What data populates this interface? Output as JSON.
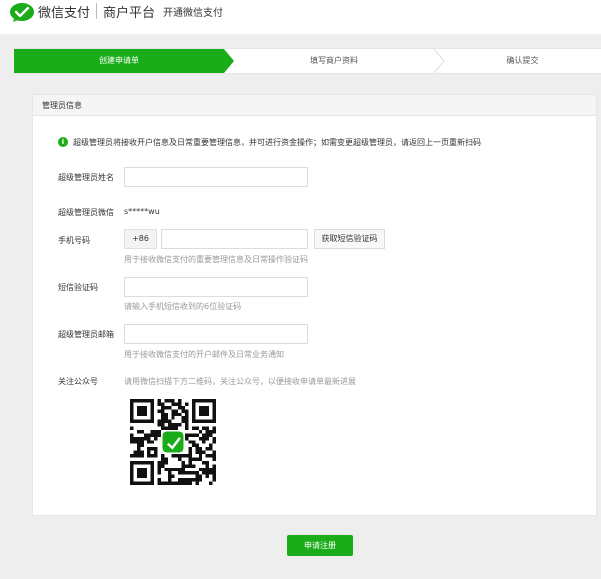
{
  "header": {
    "brand": "微信支付",
    "platform": "商户平台",
    "subtitle": "开通微信支付"
  },
  "steps": [
    {
      "label": "创建申请单",
      "active": true
    },
    {
      "label": "填写商户资料",
      "active": false
    },
    {
      "label": "确认提交",
      "active": false
    }
  ],
  "card": {
    "title": "管理员信息",
    "notice": "超级管理员将接收开户信息及日常重要管理信息，并可进行资金操作；如需变更超级管理员，请返回上一页重新扫码"
  },
  "form": {
    "name_label": "超级管理员姓名",
    "name_value": "",
    "wechat_label": "超级管理员微信",
    "wechat_value": "s*****wu",
    "phone_label": "手机号码",
    "phone_prefix": "+86",
    "phone_value": "",
    "sms_button": "获取短信验证码",
    "phone_hint": "用于接收微信支付的重要管理信息及日常操作验证码",
    "code_label": "短信验证码",
    "code_value": "",
    "code_hint": "请输入手机短信收到的6位验证码",
    "email_label": "超级管理员邮箱",
    "email_value": "",
    "email_hint": "用于接收微信支付的开户邮件及日常业务通知",
    "follow_label": "关注公众号",
    "follow_hint": "请用微信扫描下方二维码，关注公众号，以便接收申请单最新进展"
  },
  "submit_label": "申请注册",
  "colors": {
    "accent": "#1aad19",
    "page_bg": "#eeeeee"
  }
}
